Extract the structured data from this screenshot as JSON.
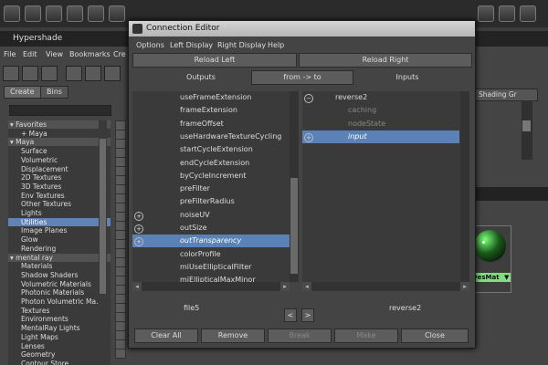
{
  "hypershade": {
    "title": "Hypershade",
    "menu": [
      "File",
      "Edit",
      "View",
      "Bookmarks",
      "Cre"
    ],
    "tabs": {
      "create": "Create",
      "bins": "Bins"
    },
    "right_tab": "Shading Gr",
    "tree": [
      {
        "label": "Favorites",
        "kind": "cat",
        "prefix": "▾ "
      },
      {
        "label": "Maya",
        "kind": "item",
        "prefix": "+ "
      },
      {
        "label": "Maya",
        "kind": "cat",
        "prefix": "▾ "
      },
      {
        "label": "Surface",
        "kind": "item",
        "prefix": ""
      },
      {
        "label": "Volumetric",
        "kind": "item",
        "prefix": ""
      },
      {
        "label": "Displacement",
        "kind": "item",
        "prefix": ""
      },
      {
        "label": "2D Textures",
        "kind": "item",
        "prefix": ""
      },
      {
        "label": "3D Textures",
        "kind": "item",
        "prefix": ""
      },
      {
        "label": "Env Textures",
        "kind": "item",
        "prefix": ""
      },
      {
        "label": "Other Textures",
        "kind": "item",
        "prefix": ""
      },
      {
        "label": "Lights",
        "kind": "item",
        "prefix": ""
      },
      {
        "label": "Utilities",
        "kind": "sel",
        "prefix": ""
      },
      {
        "label": "Image Planes",
        "kind": "item",
        "prefix": ""
      },
      {
        "label": "Glow",
        "kind": "item",
        "prefix": ""
      },
      {
        "label": "Rendering",
        "kind": "item",
        "prefix": ""
      },
      {
        "label": "mental ray",
        "kind": "cat",
        "prefix": "▾ "
      },
      {
        "label": "Materials",
        "kind": "item",
        "prefix": ""
      },
      {
        "label": "Shadow Shaders",
        "kind": "item",
        "prefix": ""
      },
      {
        "label": "Volumetric Materials",
        "kind": "item",
        "prefix": ""
      },
      {
        "label": "Photonic Materials",
        "kind": "item",
        "prefix": ""
      },
      {
        "label": "Photon Volumetric Ma...",
        "kind": "item",
        "prefix": ""
      },
      {
        "label": "Textures",
        "kind": "item",
        "prefix": ""
      },
      {
        "label": "Environments",
        "kind": "item",
        "prefix": ""
      },
      {
        "label": "MentalRay Lights",
        "kind": "item",
        "prefix": ""
      },
      {
        "label": "Light Maps",
        "kind": "item",
        "prefix": ""
      },
      {
        "label": "Lenses",
        "kind": "item",
        "prefix": ""
      },
      {
        "label": "Geometry",
        "kind": "item",
        "prefix": ""
      },
      {
        "label": "Contour Store",
        "kind": "item",
        "prefix": ""
      }
    ],
    "node_label": "ivesMat",
    "node_arrow": "▼",
    "node_color": "#7de07d"
  },
  "dialog": {
    "title": "Connection Editor",
    "menu": [
      "Options",
      "Left Display",
      "Right Display",
      "Help"
    ],
    "reload_left": "Reload Left",
    "reload_right": "Reload Right",
    "outputs_label": "Outputs",
    "from_to_label": "from -> to",
    "inputs_label": "Inputs",
    "left_attrs": [
      {
        "label": "useFrameExtension",
        "expand": false,
        "selected": false
      },
      {
        "label": "frameExtension",
        "expand": false,
        "selected": false
      },
      {
        "label": "frameOffset",
        "expand": false,
        "selected": false
      },
      {
        "label": "useHardwareTextureCycling",
        "expand": false,
        "selected": false
      },
      {
        "label": "startCycleExtension",
        "expand": false,
        "selected": false
      },
      {
        "label": "endCycleExtension",
        "expand": false,
        "selected": false
      },
      {
        "label": "byCycleIncrement",
        "expand": false,
        "selected": false
      },
      {
        "label": "preFilter",
        "expand": false,
        "selected": false
      },
      {
        "label": "preFilterRadius",
        "expand": false,
        "selected": false
      },
      {
        "label": "noiseUV",
        "expand": true,
        "selected": false
      },
      {
        "label": "outSize",
        "expand": true,
        "selected": false
      },
      {
        "label": "outTransparency",
        "expand": true,
        "selected": true
      },
      {
        "label": "colorProfile",
        "expand": false,
        "selected": false
      },
      {
        "label": "miUseEllipticalFilter",
        "expand": false,
        "selected": false
      },
      {
        "label": "miEllipticalMaxMinor",
        "expand": false,
        "selected": false
      }
    ],
    "right_attrs": [
      {
        "label": "reverse2",
        "expand": "minus",
        "indent": 1,
        "dim": false,
        "selected": false
      },
      {
        "label": "caching",
        "expand": "",
        "indent": 2,
        "dim": true,
        "selected": false
      },
      {
        "label": "nodeState",
        "expand": "",
        "indent": 2,
        "dim": true,
        "selected": false
      },
      {
        "label": "input",
        "expand": "plus",
        "indent": 2,
        "dim": false,
        "selected": true
      }
    ],
    "left_node": "file5",
    "right_node": "reverse2",
    "prev_label": "<",
    "next_label": ">",
    "buttons": {
      "clear_all": "Clear All",
      "remove": "Remove",
      "break": "Break",
      "make": "Make",
      "close": "Close"
    },
    "selection_color": "#5b82b6"
  }
}
